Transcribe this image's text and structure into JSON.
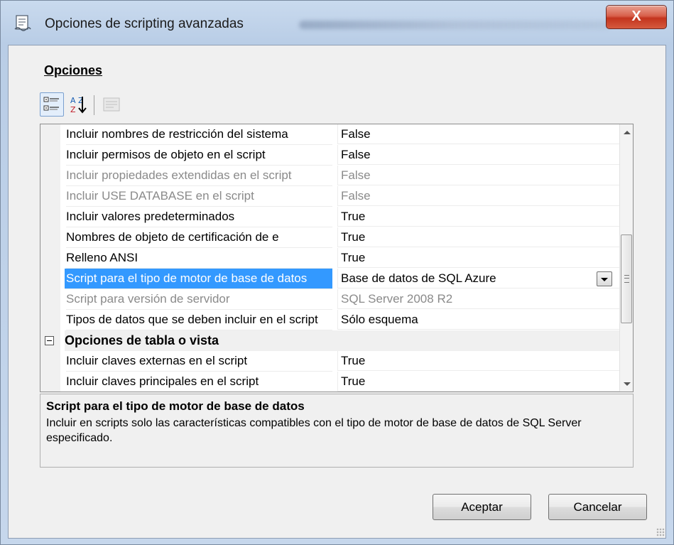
{
  "window": {
    "title": "Opciones de scripting avanzadas",
    "close_label": "X"
  },
  "section": {
    "label": "Opciones"
  },
  "toolbar": {
    "alpha_label": "A Z"
  },
  "grid": {
    "rows": [
      {
        "name": "Incluir nombres de restricción del sistema",
        "value": "False",
        "state": "normal"
      },
      {
        "name": "Incluir permisos de objeto en el script",
        "value": "False",
        "state": "normal"
      },
      {
        "name": "Incluir propiedades extendidas en el script",
        "value": "False",
        "state": "disabled"
      },
      {
        "name": "Incluir USE DATABASE en el script",
        "value": "False",
        "state": "disabled"
      },
      {
        "name": "Incluir valores predeterminados",
        "value": "True",
        "state": "normal"
      },
      {
        "name": "Nombres de objeto de certificación de e",
        "value": "True",
        "state": "normal"
      },
      {
        "name": "Relleno ANSI",
        "value": "True",
        "state": "normal"
      },
      {
        "name": "Script para el tipo de motor de base de datos",
        "value": "Base de datos de SQL Azure",
        "state": "selected"
      },
      {
        "name": "Script para versión de servidor",
        "value": "SQL Server 2008 R2",
        "state": "disabled"
      },
      {
        "name": "Tipos de datos que se deben incluir en el script",
        "value": "Sólo esquema",
        "state": "normal"
      },
      {
        "category": "Opciones de tabla o vista"
      },
      {
        "name": "Incluir claves externas en el script",
        "value": "True",
        "state": "normal"
      },
      {
        "name": "Incluir claves principales en el script",
        "value": "True",
        "state": "normal"
      }
    ]
  },
  "description": {
    "title": "Script para el tipo de motor de base de datos",
    "text": "Incluir en scripts solo las características compatibles con el tipo de motor de base de datos de SQL Server especificado."
  },
  "buttons": {
    "ok": "Aceptar",
    "cancel": "Cancelar"
  }
}
